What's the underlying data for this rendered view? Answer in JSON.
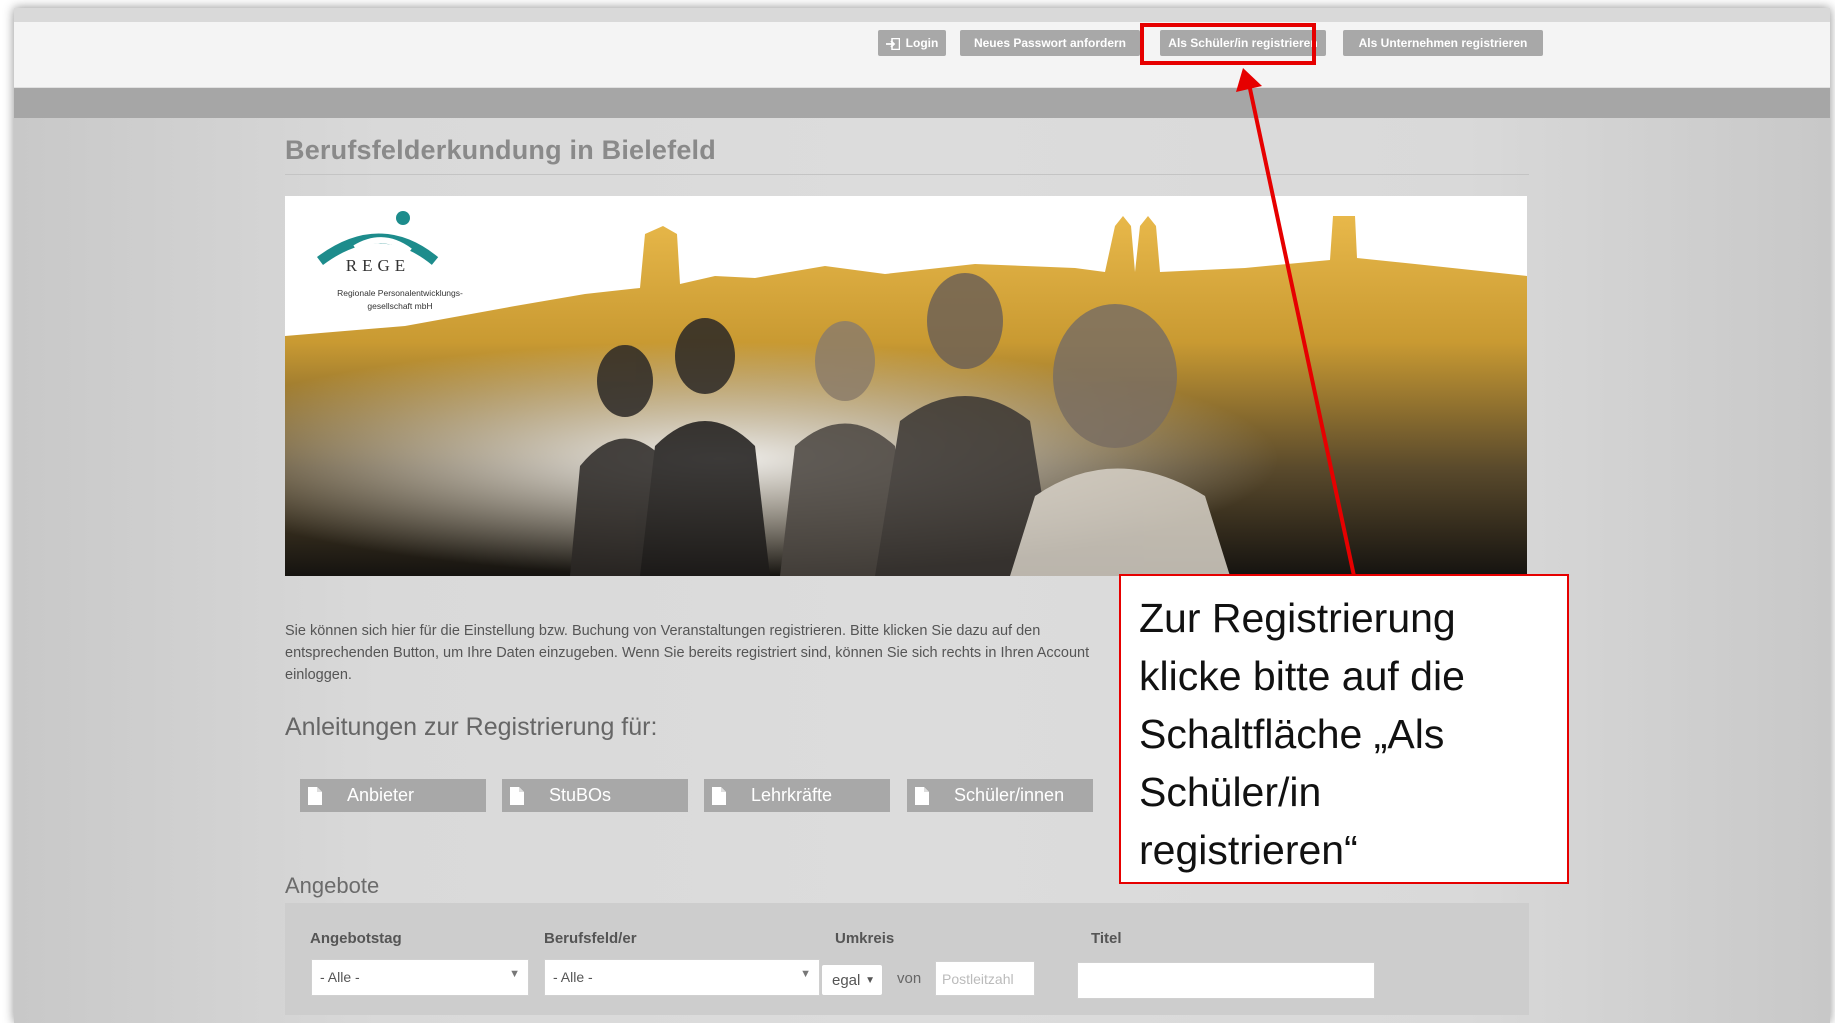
{
  "topbar": {
    "login": "Login",
    "neues_passwort": "Neues Passwort anfordern",
    "als_schueler": "Als Schüler/in registrieren",
    "als_unternehmen": "Als Unternehmen registrieren"
  },
  "page": {
    "title": "Berufsfelderkundung in Bielefeld",
    "intro": "Sie können sich hier für die Einstellung bzw. Buchung von Veranstaltungen registrieren. Bitte klicken Sie dazu auf den entsprechenden Button, um Ihre Daten einzugeben. Wenn Sie bereits registriert sind, können Sie sich rechts in Ihren Account einloggen.",
    "anleitungen_heading": "Anleitungen zur Registrierung für:",
    "anleitungen": [
      "Anbieter",
      "StuBOs",
      "Lehrkräfte",
      "Schüler/innen"
    ]
  },
  "banner": {
    "logo_name": "REGE",
    "logo_line1": "Regionale Personalentwicklungs-",
    "logo_line2": "gesellschaft mbH"
  },
  "offers": {
    "heading": "Angebote",
    "label_angebotstag": "Angebotstag",
    "label_berufsfeld": "Berufsfeld/er",
    "label_umkreis": "Umkreis",
    "label_titel": "Titel",
    "angebotstag_value": "- Alle -",
    "berufsfeld_value": "- Alle -",
    "umkreis_value": "egal",
    "von": "von",
    "plz_placeholder": "Postleitzahl",
    "titel_value": ""
  },
  "callout": {
    "line1": "Zur Registrierung",
    "line2": "klicke bitte auf die",
    "line3": "Schaltfläche „Als",
    "line4": "Schüler/in",
    "line5": "registrieren“"
  },
  "colors": {
    "highlight": "#e60000",
    "button_gray": "#a8a8a8",
    "banner_gold": "#d9a52c"
  }
}
